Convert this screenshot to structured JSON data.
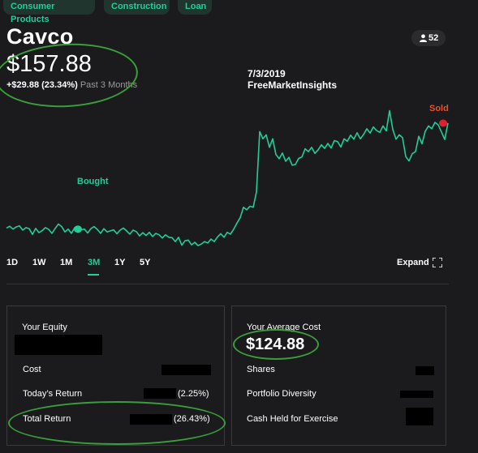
{
  "tags": [
    "Consumer Products",
    "Construction",
    "Loan"
  ],
  "stock": {
    "title": "Cavco",
    "price": "$157.88",
    "change": "+$29.88 (23.34%)",
    "period_label": "Past 3 Months",
    "followers": "52"
  },
  "annotations": {
    "date": "7/3/2019",
    "source": "FreeMarketInsights",
    "bought": "Bought",
    "sold": "Sold"
  },
  "chart_data": {
    "type": "line",
    "color": "#21ce99",
    "points": [
      [
        0,
        128.5
      ],
      [
        4,
        129.0
      ],
      [
        8,
        128.2
      ],
      [
        12,
        128.8
      ],
      [
        16,
        129.1
      ],
      [
        20,
        127.9
      ],
      [
        24,
        128.6
      ],
      [
        28,
        128.3
      ],
      [
        32,
        126.7
      ],
      [
        36,
        128.4
      ],
      [
        40,
        127.2
      ],
      [
        44,
        127.8
      ],
      [
        48,
        128.6
      ],
      [
        52,
        128.1
      ],
      [
        56,
        127.0
      ],
      [
        60,
        128.4
      ],
      [
        64,
        129.6
      ],
      [
        68,
        128.9
      ],
      [
        72,
        127.4
      ],
      [
        76,
        128.2
      ],
      [
        80,
        127.0
      ],
      [
        84,
        128.6
      ],
      [
        88,
        127.6
      ],
      [
        92,
        128.0
      ],
      [
        96,
        128.2
      ],
      [
        100,
        127.1
      ],
      [
        104,
        128.3
      ],
      [
        108,
        128.9
      ],
      [
        112,
        128.1
      ],
      [
        116,
        127.0
      ],
      [
        120,
        128.3
      ],
      [
        124,
        127.4
      ],
      [
        128,
        127.7
      ],
      [
        132,
        128.0
      ],
      [
        136,
        126.9
      ],
      [
        140,
        127.9
      ],
      [
        144,
        128.5
      ],
      [
        148,
        127.7
      ],
      [
        152,
        126.8
      ],
      [
        156,
        127.9
      ],
      [
        160,
        127.5
      ],
      [
        164,
        126.3
      ],
      [
        168,
        127.2
      ],
      [
        172,
        126.4
      ],
      [
        176,
        127.3
      ],
      [
        180,
        126.1
      ],
      [
        184,
        127.0
      ],
      [
        188,
        126.6
      ],
      [
        192,
        125.7
      ],
      [
        196,
        126.6
      ],
      [
        200,
        125.9
      ],
      [
        204,
        125.8
      ],
      [
        208,
        124.7
      ],
      [
        212,
        125.9
      ],
      [
        216,
        123.7
      ],
      [
        220,
        124.9
      ],
      [
        224,
        125.1
      ],
      [
        228,
        123.8
      ],
      [
        232,
        124.5
      ],
      [
        236,
        123.6
      ],
      [
        240,
        124.0
      ],
      [
        244,
        124.7
      ],
      [
        248,
        124.3
      ],
      [
        252,
        125.4
      ],
      [
        256,
        124.7
      ],
      [
        260,
        126.0
      ],
      [
        264,
        126.9
      ],
      [
        268,
        125.9
      ],
      [
        272,
        127.3
      ],
      [
        276,
        126.8
      ],
      [
        280,
        128.2
      ],
      [
        284,
        129.9
      ],
      [
        288,
        131.4
      ],
      [
        292,
        134.3
      ],
      [
        296,
        133.6
      ],
      [
        300,
        134.6
      ],
      [
        304,
        134.3
      ],
      [
        308,
        138.6
      ],
      [
        312,
        155.5
      ],
      [
        316,
        153.5
      ],
      [
        320,
        154.6
      ],
      [
        324,
        151.1
      ],
      [
        328,
        153.5
      ],
      [
        332,
        149.1
      ],
      [
        336,
        147.9
      ],
      [
        340,
        149.5
      ],
      [
        344,
        147.2
      ],
      [
        348,
        148.3
      ],
      [
        352,
        146.1
      ],
      [
        356,
        146.3
      ],
      [
        360,
        148.0
      ],
      [
        364,
        148.4
      ],
      [
        368,
        150.7
      ],
      [
        372,
        149.9
      ],
      [
        376,
        151.1
      ],
      [
        380,
        149.4
      ],
      [
        384,
        150.4
      ],
      [
        388,
        151.8
      ],
      [
        392,
        150.8
      ],
      [
        396,
        152.2
      ],
      [
        400,
        150.9
      ],
      [
        404,
        153.0
      ],
      [
        408,
        152.7
      ],
      [
        412,
        151.2
      ],
      [
        416,
        153.5
      ],
      [
        420,
        152.8
      ],
      [
        424,
        154.5
      ],
      [
        428,
        153.4
      ],
      [
        432,
        155.2
      ],
      [
        436,
        153.5
      ],
      [
        440,
        154.7
      ],
      [
        444,
        156.3
      ],
      [
        448,
        155.1
      ],
      [
        452,
        156.8
      ],
      [
        456,
        155.8
      ],
      [
        460,
        155.3
      ],
      [
        464,
        157.1
      ],
      [
        468,
        155.7
      ],
      [
        472,
        161.4
      ],
      [
        476,
        156.1
      ],
      [
        480,
        153.4
      ],
      [
        484,
        154.6
      ],
      [
        488,
        153.8
      ],
      [
        492,
        148.5
      ],
      [
        496,
        147.3
      ],
      [
        500,
        149.3
      ],
      [
        504,
        149.9
      ],
      [
        508,
        154.2
      ],
      [
        512,
        152.1
      ],
      [
        516,
        155.6
      ],
      [
        520,
        157.1
      ],
      [
        524,
        156.3
      ],
      [
        528,
        158.1
      ],
      [
        532,
        157.4
      ],
      [
        536,
        155.4
      ],
      [
        540,
        153.3
      ],
      [
        544,
        157.9
      ]
    ],
    "markers": [
      {
        "label": "Bought",
        "x": 96,
        "y": 128.2,
        "color": "#21ce99"
      },
      {
        "label": "Sold",
        "x": 546,
        "y": 157.88,
        "color": "#e0202f"
      }
    ],
    "ylim": [
      122,
      164
    ],
    "periods": [
      "1D",
      "1W",
      "1M",
      "3M",
      "1Y",
      "5Y"
    ],
    "active_period": "3M",
    "expand_label": "Expand"
  },
  "equity_panel": {
    "title": "Your Equity",
    "cost_label": "Cost",
    "todays_return_label": "Today’s Return",
    "todays_return_pct": "(2.25%)",
    "total_return_label": "Total Return",
    "total_return_pct": "(26.43%)"
  },
  "avg_cost_panel": {
    "title": "Your Average Cost",
    "value": "$124.88",
    "shares_label": "Shares",
    "diversity_label": "Portfolio Diversity",
    "cash_label": "Cash Held for Exercise"
  }
}
